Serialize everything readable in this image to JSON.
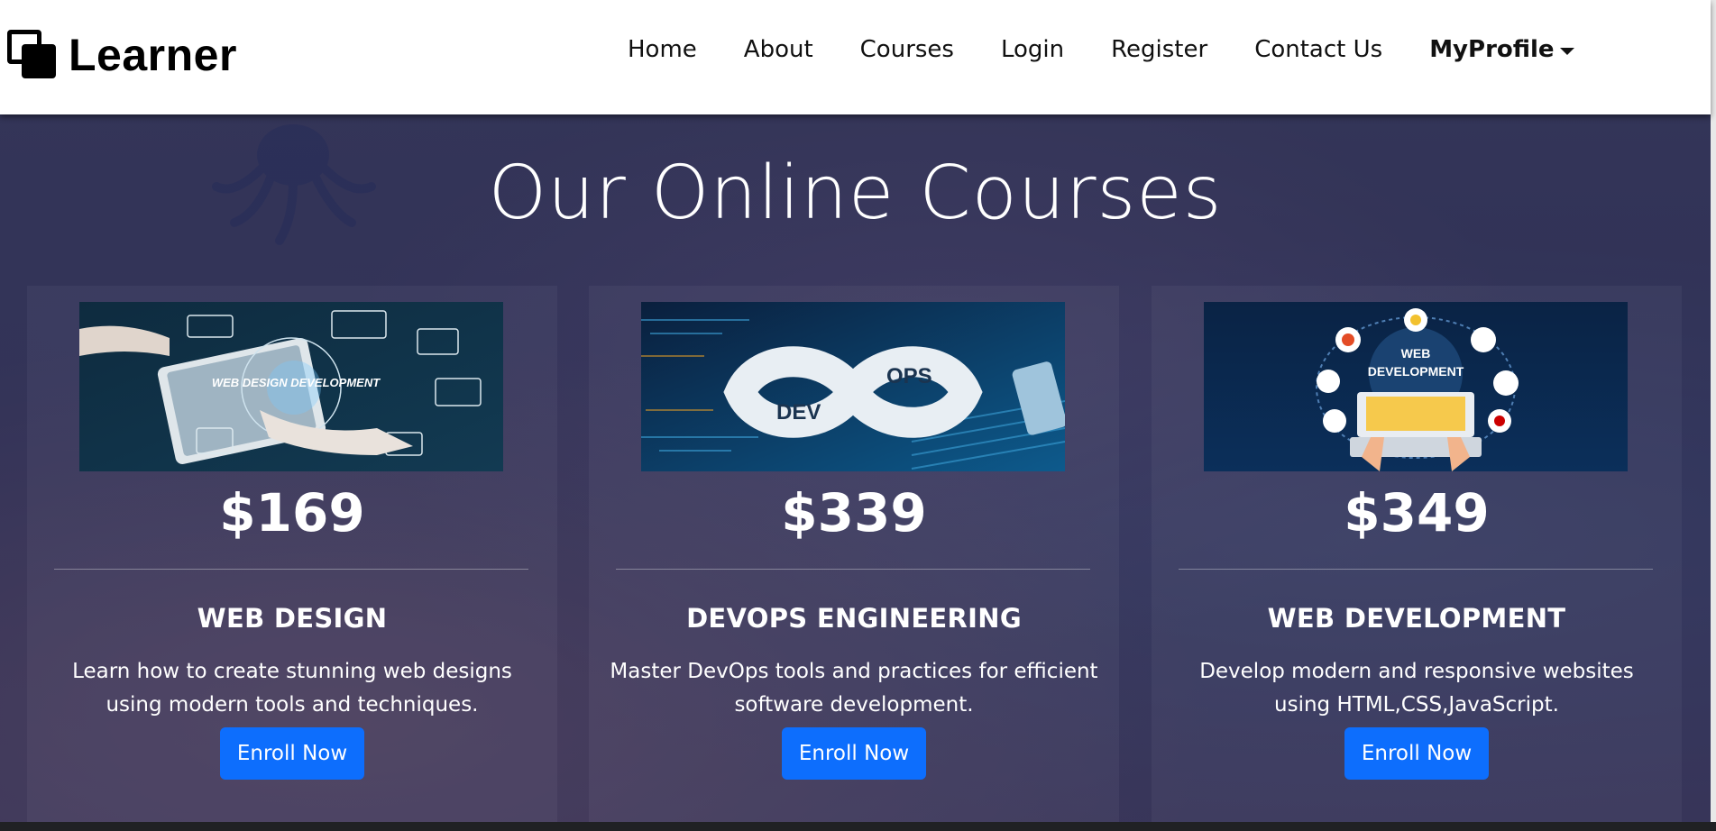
{
  "brand": {
    "name": "Learner",
    "logo_icon": "overlapping-squares-icon"
  },
  "nav": {
    "items": [
      {
        "label": "Home"
      },
      {
        "label": "About"
      },
      {
        "label": "Courses"
      },
      {
        "label": "Login"
      },
      {
        "label": "Register"
      },
      {
        "label": "Contact Us"
      }
    ],
    "profile_label": "MyProfile"
  },
  "page": {
    "title": "Our Online Courses"
  },
  "courses": [
    {
      "image_text": "WEB DESIGN DEVELOPMENT",
      "price": "$169",
      "title": "WEB DESIGN",
      "description": "Learn how to create stunning web designs using modern tools and techniques.",
      "button_label": "Enroll Now"
    },
    {
      "image_text_left": "DEV",
      "image_text_right": "OPS",
      "price": "$339",
      "title": "DEVOPS ENGINEERING",
      "description": "Master DevOps tools and practices for efficient software development.",
      "button_label": "Enroll Now"
    },
    {
      "image_text_line1": "WEB",
      "image_text_line2": "DEVELOPMENT",
      "price": "$349",
      "title": "WEB DEVELOPMENT",
      "description": "Develop modern and responsive websites using HTML,CSS,JavaScript.",
      "button_label": "Enroll Now"
    }
  ],
  "colors": {
    "primary_button": "#0d6efd",
    "navbar": "#ffffff",
    "hero_overlay": "#2b2d49"
  }
}
